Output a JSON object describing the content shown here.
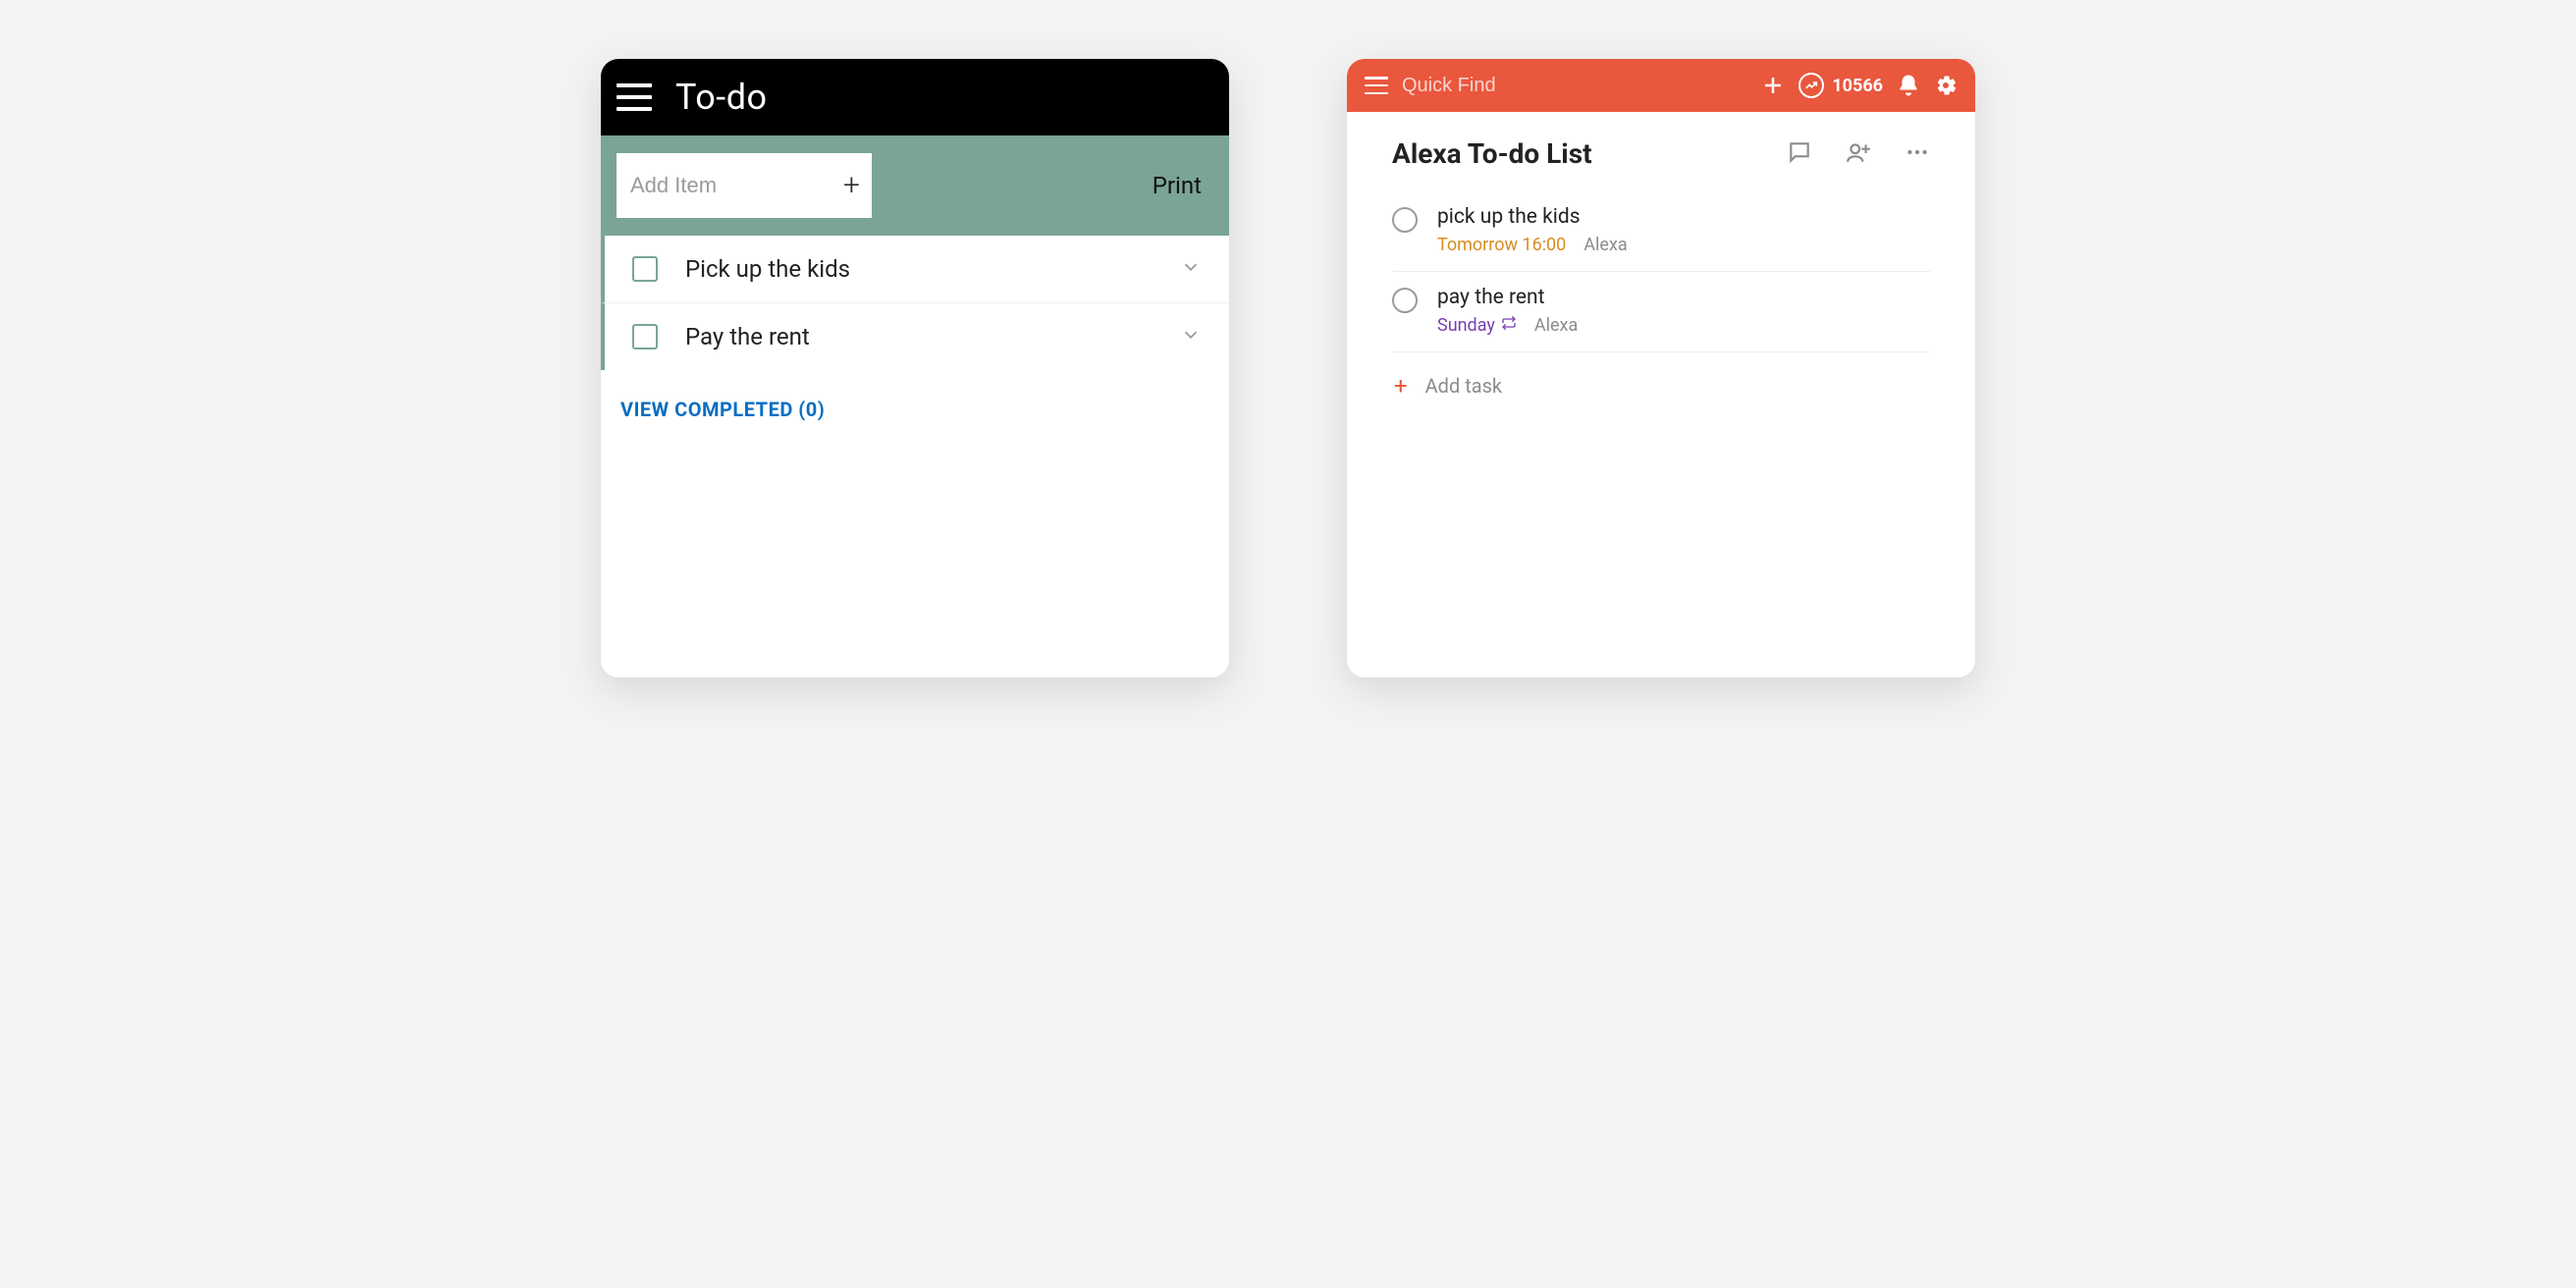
{
  "left": {
    "title": "To-do",
    "add_placeholder": "Add Item",
    "print_label": "Print",
    "items": [
      {
        "label": "Pick up the kids"
      },
      {
        "label": "Pay the rent"
      }
    ],
    "view_completed_label": "VIEW COMPLETED (0)"
  },
  "right": {
    "search_placeholder": "Quick Find",
    "karma_points": "10566",
    "title": "Alexa To-do List",
    "tasks": [
      {
        "label": "pick up the kids",
        "due": "Tomorrow 16:00",
        "due_style": "orange",
        "source": "Alexa",
        "repeat": false
      },
      {
        "label": "pay the rent",
        "due": "Sunday",
        "due_style": "purple",
        "source": "Alexa",
        "repeat": true
      }
    ],
    "add_task_label": "Add task"
  }
}
